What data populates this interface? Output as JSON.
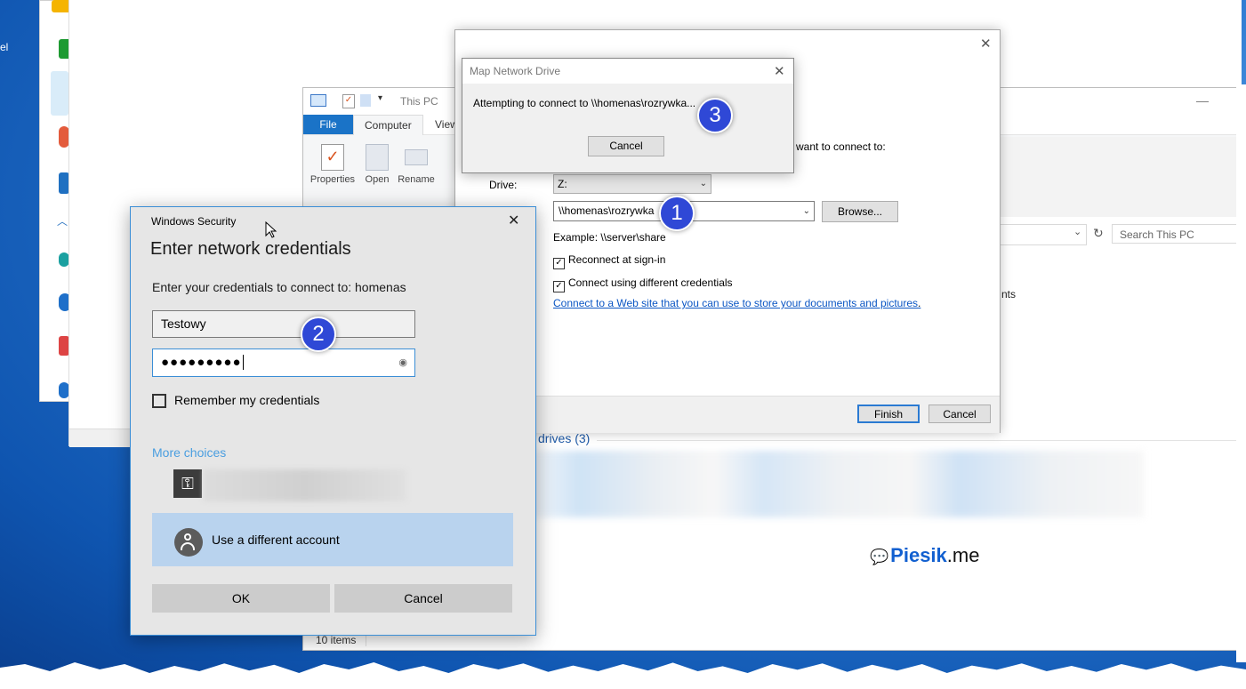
{
  "desktop": {
    "left_label": "el"
  },
  "explorer": {
    "title": "This PC",
    "tabs": [
      "File",
      "Computer",
      "View"
    ],
    "ribbon": [
      "Properties",
      "Open",
      "Rename"
    ],
    "search_placeholder": "Search This PC",
    "partial_text": "nts",
    "drives_heading": "drives (3)",
    "status": "10 items"
  },
  "wizard": {
    "want_text": "want to connect to:",
    "drive_label": "Drive:",
    "drive_value": "Z:",
    "folder_value": "\\\\homenas\\rozrywka",
    "browse_label": "Browse...",
    "example": "Example: \\\\server\\share",
    "reconnect_label": "Reconnect at sign-in",
    "reconnect_checked": true,
    "diff_cred_label": "Connect using different credentials",
    "diff_cred_checked": true,
    "web_link": "Connect to a Web site that you can use to store your documents and pictures",
    "finish_label": "Finish",
    "cancel_label": "Cancel"
  },
  "popup": {
    "title": "Map Network Drive",
    "message": "Attempting to connect to \\\\homenas\\rozrywka...",
    "cancel_label": "Cancel"
  },
  "security": {
    "title": "Windows Security",
    "heading": "Enter network credentials",
    "subtitle": "Enter your credentials to connect to: homenas",
    "username": "Testowy",
    "password_mask": "●●●●●●●●●",
    "remember_label": "Remember my credentials",
    "more_choices": "More choices",
    "use_different": "Use a different account",
    "ok_label": "OK",
    "cancel_label": "Cancel"
  },
  "badges": [
    "1",
    "2",
    "3"
  ],
  "watermark": {
    "brand": "Piesik",
    "suffix": ".me"
  },
  "colors": {
    "accent": "#2f48d6",
    "link": "#0b56c4",
    "selection": "#b9d3ee"
  }
}
